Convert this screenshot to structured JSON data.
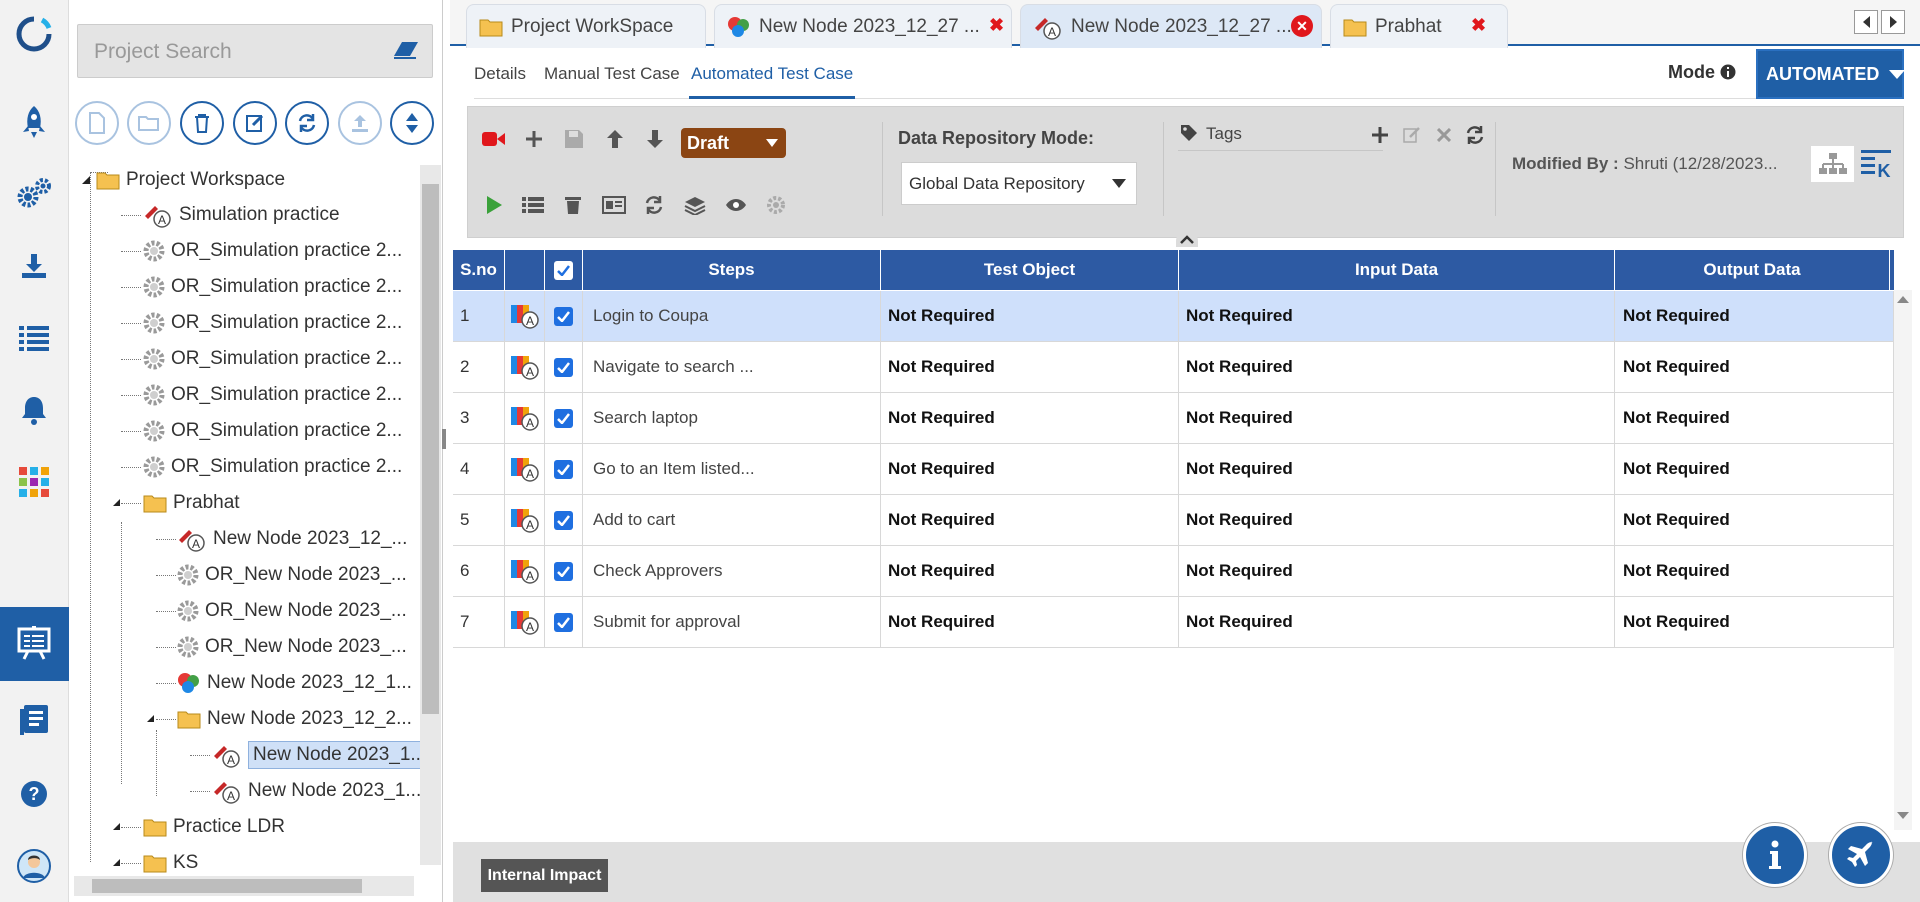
{
  "search": {
    "placeholder": "Project Search"
  },
  "tree": {
    "root": "Project Workspace",
    "items": [
      {
        "label": "Simulation practice",
        "type": "test"
      },
      {
        "label": "OR_Simulation practice 2...",
        "type": "gear"
      },
      {
        "label": "OR_Simulation practice 2...",
        "type": "gear"
      },
      {
        "label": "OR_Simulation practice 2...",
        "type": "gear"
      },
      {
        "label": "OR_Simulation practice 2...",
        "type": "gear"
      },
      {
        "label": "OR_Simulation practice 2...",
        "type": "gear"
      },
      {
        "label": "OR_Simulation practice 2...",
        "type": "gear"
      },
      {
        "label": "OR_Simulation practice 2...",
        "type": "gear"
      },
      {
        "label": "Prabhat",
        "type": "folder"
      },
      {
        "label": "New Node 2023_12_...",
        "type": "test"
      },
      {
        "label": "OR_New Node 2023_...",
        "type": "gear"
      },
      {
        "label": "OR_New Node 2023_...",
        "type": "gear"
      },
      {
        "label": "OR_New Node 2023_...",
        "type": "gear"
      },
      {
        "label": "New Node 2023_12_1...",
        "type": "model"
      },
      {
        "label": "New Node 2023_12_2...",
        "type": "folder"
      },
      {
        "label": "New Node 2023_1...",
        "type": "test"
      },
      {
        "label": "New Node 2023_1...",
        "type": "test"
      },
      {
        "label": "Practice LDR",
        "type": "folder"
      },
      {
        "label": "KS",
        "type": "folder"
      }
    ]
  },
  "tabs": [
    {
      "label": "Project WorkSpace"
    },
    {
      "label": "New Node 2023_12_27 ..."
    },
    {
      "label": "New Node 2023_12_27 ..."
    },
    {
      "label": "Prabhat"
    }
  ],
  "subtabs": {
    "details": "Details",
    "manual": "Manual Test Case",
    "automated": "Automated Test Case"
  },
  "mode": {
    "label": "Mode",
    "value": "AUTOMATED"
  },
  "toolbar": {
    "status": "Draft",
    "repo_label": "Data Repository Mode:",
    "repo_value": "Global Data Repository",
    "tags_label": "Tags",
    "modified_label": "Modified By :",
    "modified_value": "Shruti (12/28/2023..."
  },
  "grid": {
    "headers": {
      "sno": "S.no",
      "steps": "Steps",
      "object": "Test Object",
      "input": "Input Data",
      "output": "Output Data"
    },
    "rows": [
      {
        "sno": "1",
        "step": "Login to Coupa",
        "object": "Not Required",
        "input": "Not Required",
        "output": "Not Required"
      },
      {
        "sno": "2",
        "step": "Navigate to search ...",
        "object": "Not Required",
        "input": "Not Required",
        "output": "Not Required"
      },
      {
        "sno": "3",
        "step": "Search laptop",
        "object": "Not Required",
        "input": "Not Required",
        "output": "Not Required"
      },
      {
        "sno": "4",
        "step": "Go to an Item listed...",
        "object": "Not Required",
        "input": "Not Required",
        "output": "Not Required"
      },
      {
        "sno": "5",
        "step": "Add to cart",
        "object": "Not Required",
        "input": "Not Required",
        "output": "Not Required"
      },
      {
        "sno": "6",
        "step": "Check Approvers",
        "object": "Not Required",
        "input": "Not Required",
        "output": "Not Required"
      },
      {
        "sno": "7",
        "step": "Submit for approval",
        "object": "Not Required",
        "input": "Not Required",
        "output": "Not Required"
      }
    ]
  },
  "bottom": {
    "impact": "Internal Impact"
  },
  "colors": {
    "accent": "#1f5fa6",
    "draft": "#8b4513",
    "close": "#e0171c"
  }
}
